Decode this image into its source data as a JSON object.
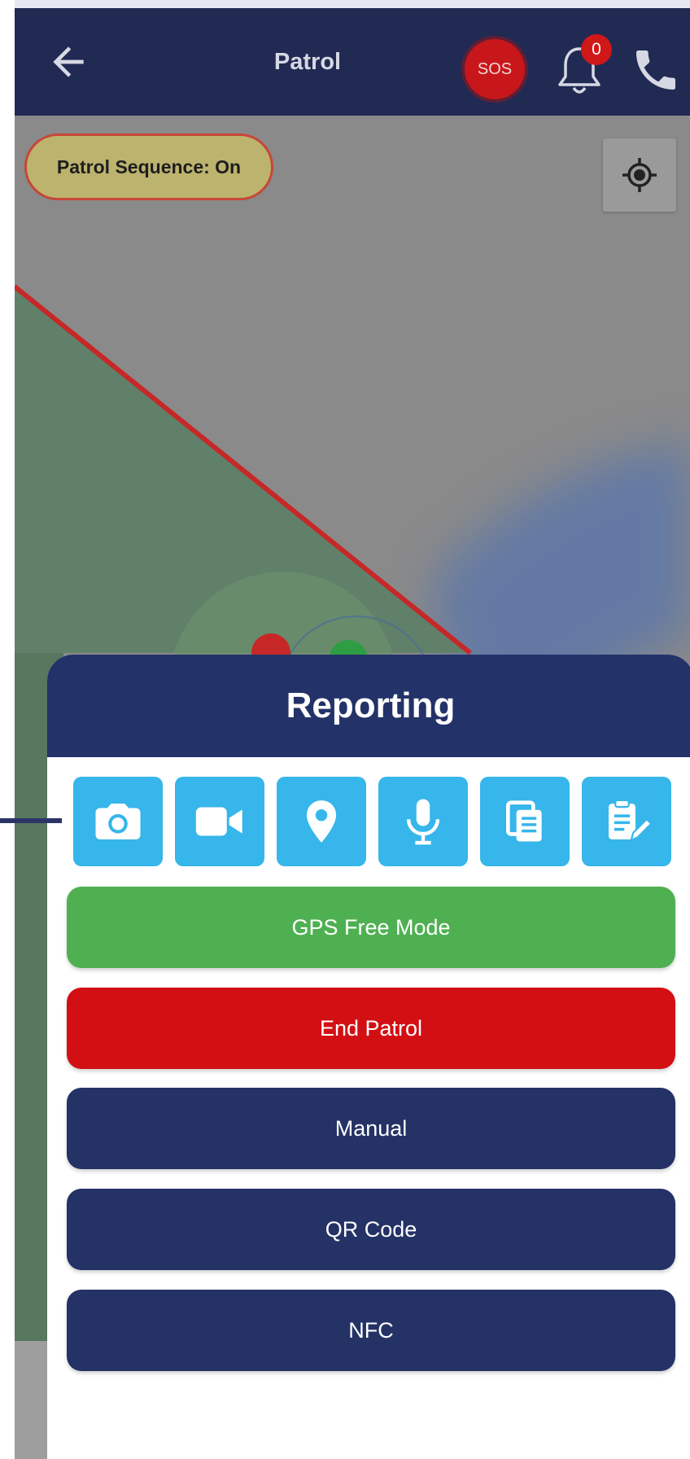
{
  "app": {
    "title": "Patrol",
    "sos_label": "SOS",
    "notification_count": "0",
    "icons": {
      "back": "arrow-left-icon",
      "notifications": "bell-icon",
      "call": "phone-icon",
      "locate": "crosshair-icon"
    }
  },
  "map": {
    "patrol_sequence": "Patrol Sequence: On",
    "colors": {
      "zone_fill": "#60806a",
      "zone_border": "#c62828",
      "marker_red": "#c62828",
      "marker_green": "#2e9e44"
    }
  },
  "reporting": {
    "title": "Reporting",
    "tools": [
      {
        "name": "camera",
        "icon": "camera-icon"
      },
      {
        "name": "video",
        "icon": "video-camera-icon"
      },
      {
        "name": "location",
        "icon": "map-pin-icon"
      },
      {
        "name": "audio",
        "icon": "microphone-icon"
      },
      {
        "name": "documents",
        "icon": "copy-documents-icon"
      },
      {
        "name": "notes",
        "icon": "clipboard-edit-icon"
      }
    ],
    "buttons": {
      "gps_free_mode": "GPS Free Mode",
      "end_patrol": "End Patrol",
      "manual": "Manual",
      "qr_code": "QR Code",
      "nfc": "NFC"
    },
    "colors": {
      "header": "#233268",
      "tool": "#36b6ea",
      "gps_free_mode": "#4fb052",
      "end_patrol": "#d21014",
      "navy": "#243266"
    }
  }
}
